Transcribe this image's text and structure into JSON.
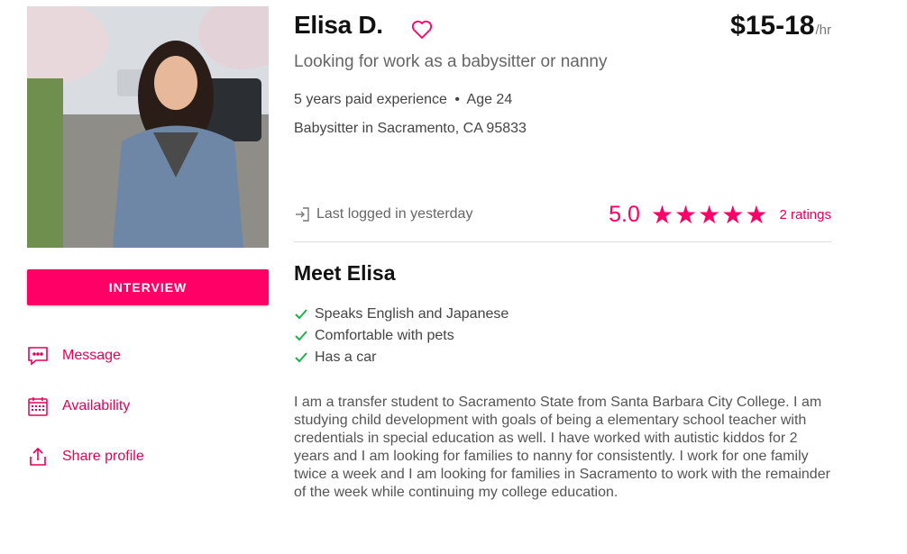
{
  "profile": {
    "name": "Elisa D.",
    "tagline": "Looking for work as a babysitter or nanny",
    "experience": "5 years paid experience",
    "age": "Age 24",
    "location": "Babysitter in Sacramento, CA 95833",
    "price": "$15-18",
    "price_unit": "/hr",
    "last_logged": "Last logged in yesterday",
    "rating": "5.0",
    "stars": 5,
    "ratings_count": "2 ratings"
  },
  "actions": {
    "interview": "INTERVIEW",
    "message": "Message",
    "availability": "Availability",
    "share": "Share profile"
  },
  "meet": {
    "title": "Meet Elisa",
    "features": [
      "Speaks English and Japanese",
      "Comfortable with pets",
      "Has a car"
    ],
    "bio": "I am a transfer student to Sacramento State from Santa Barbara City College. I am studying child development with goals of being a elementary school teacher with credentials in special education as well. I have worked with autistic kiddos for 2 years and I am looking for families to nanny for consistently. I work for one family twice a week and I am looking for families in Sacramento to work with the remainder of the week while continuing my college education."
  },
  "colors": {
    "accent": "#ff0066",
    "check": "#22b04b"
  },
  "icons": [
    "heart-icon",
    "chat-icon",
    "calendar-icon",
    "share-icon",
    "login-icon",
    "star-icon",
    "check-icon"
  ]
}
